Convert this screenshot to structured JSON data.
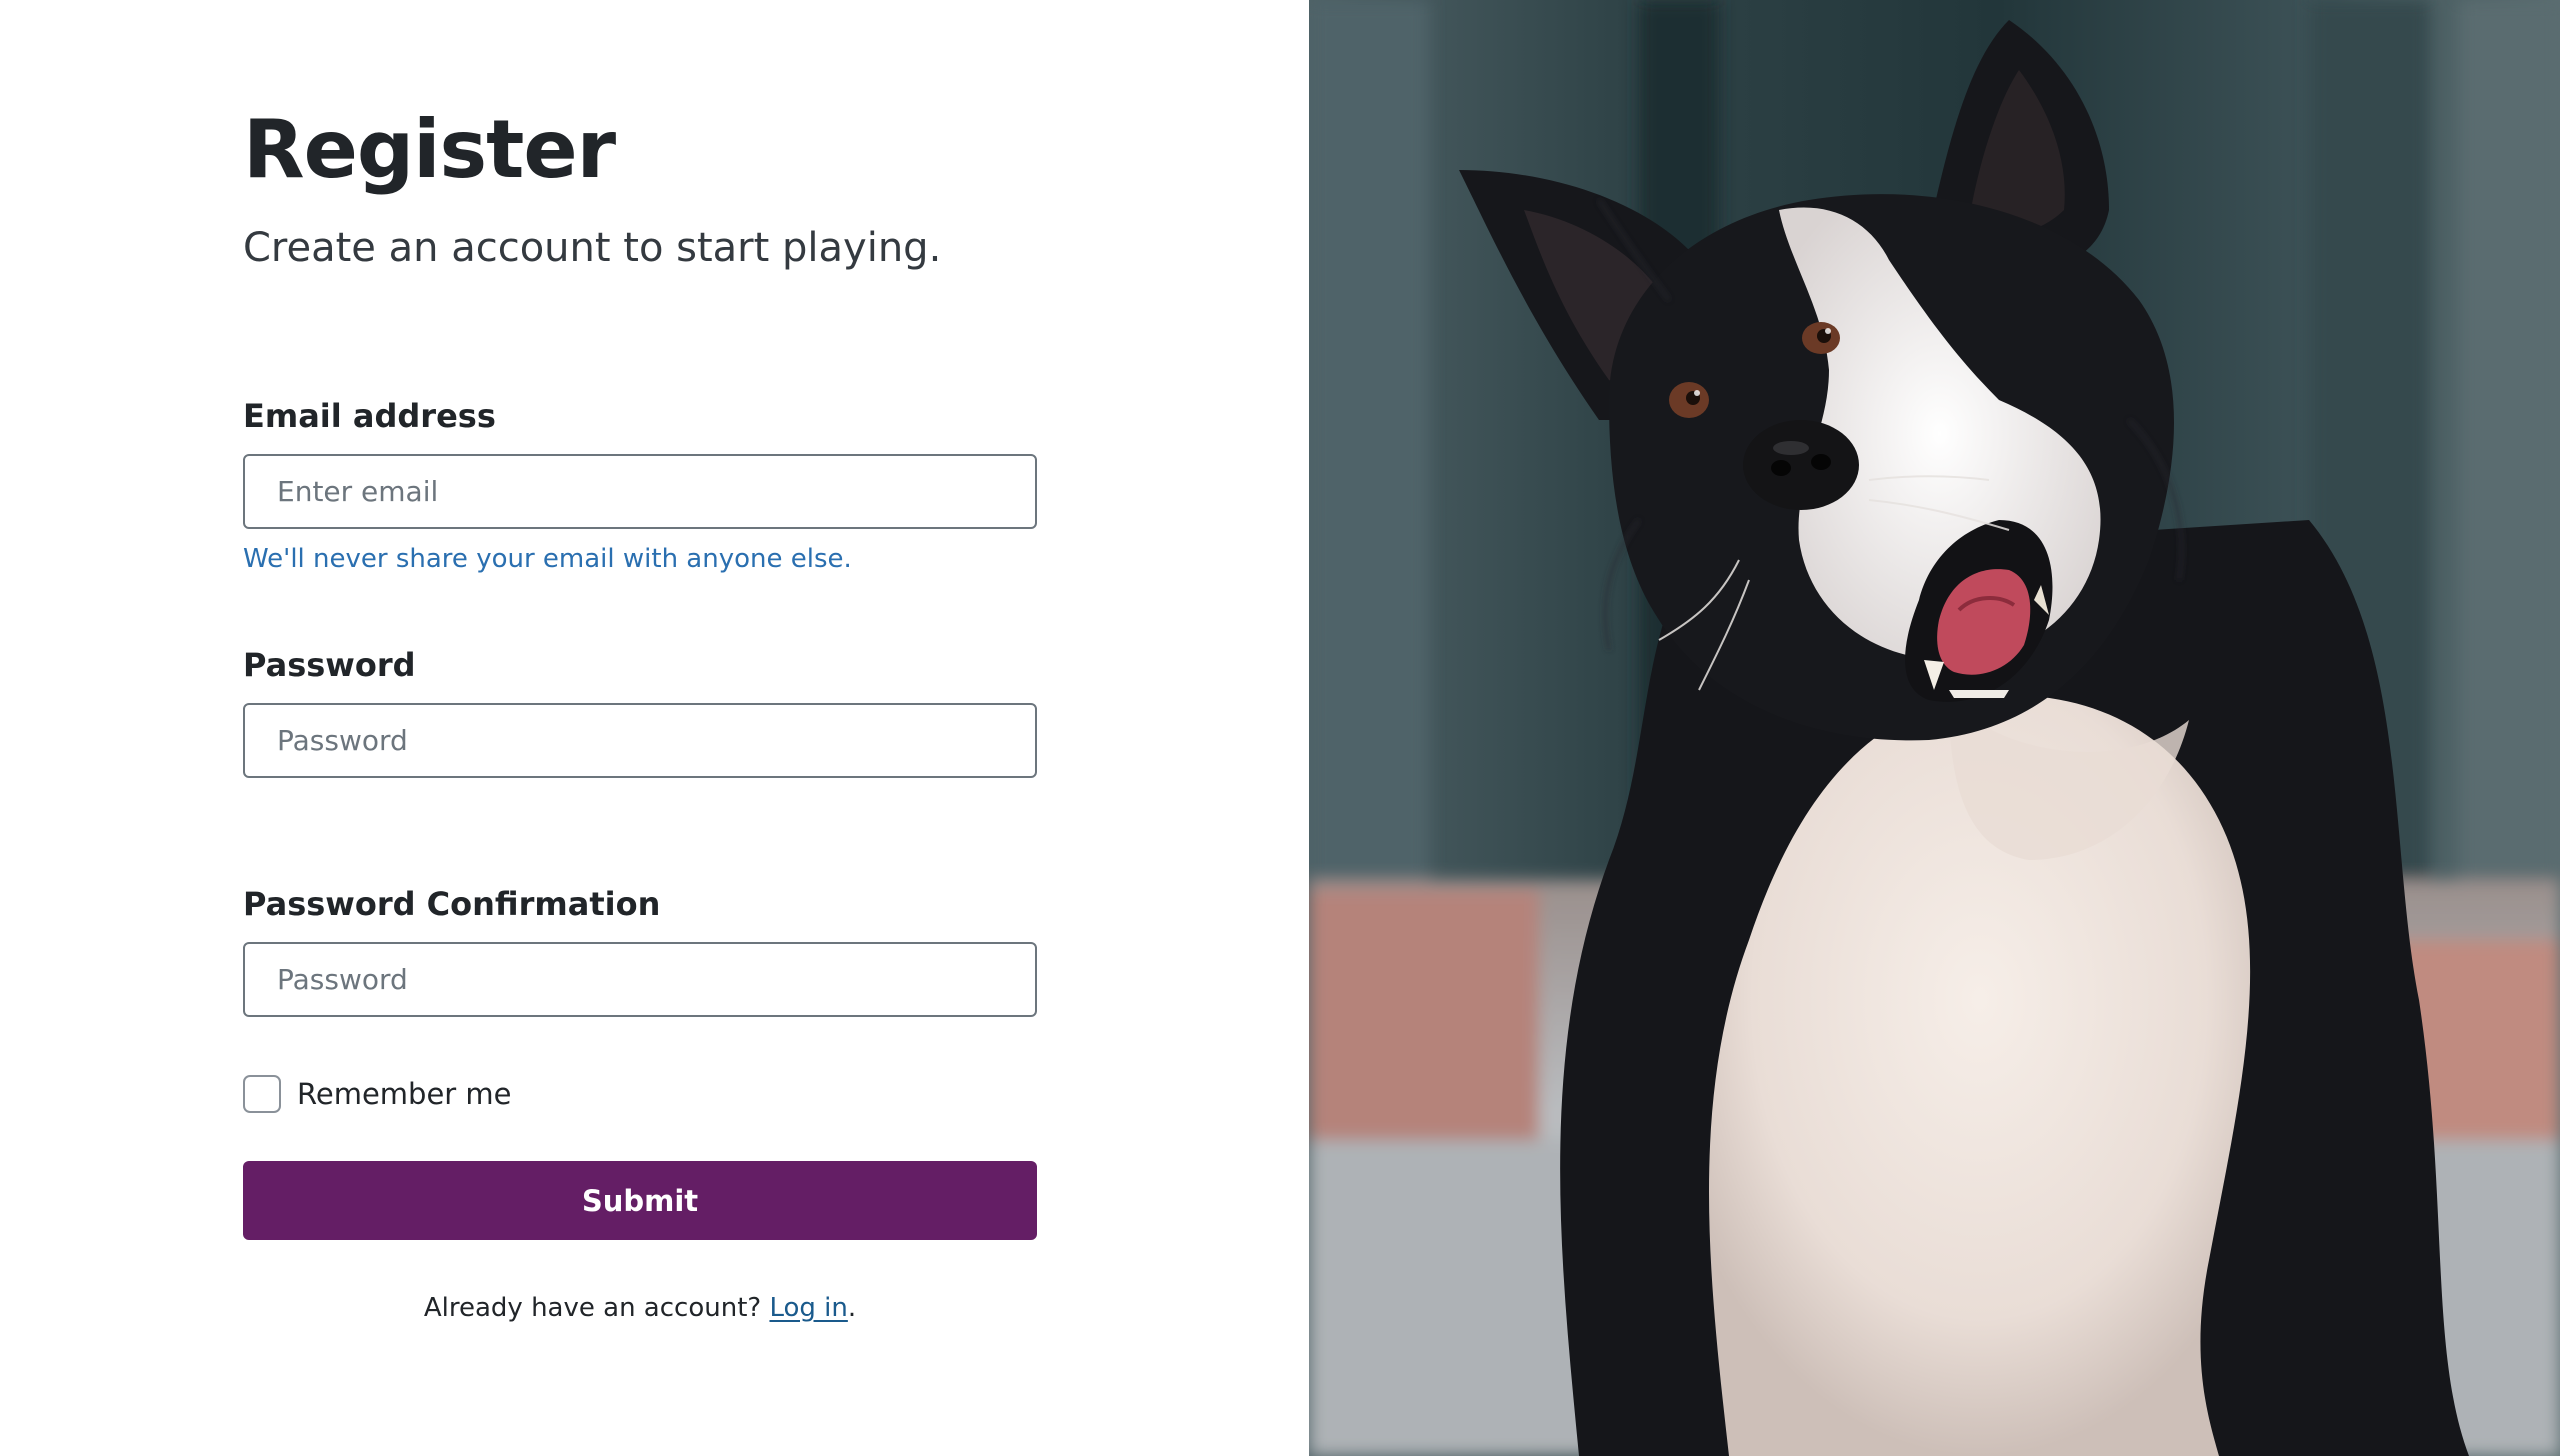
{
  "header": {
    "title": "Register",
    "subtitle": "Create an account to start playing."
  },
  "form": {
    "email": {
      "label": "Email address",
      "placeholder": "Enter email",
      "value": "",
      "help": "We'll never share your email with anyone else."
    },
    "password": {
      "label": "Password",
      "placeholder": "Password",
      "value": ""
    },
    "password_confirmation": {
      "label": "Password Confirmation",
      "placeholder": "Password",
      "value": ""
    },
    "remember": {
      "label": "Remember me",
      "checked": false
    },
    "submit_label": "Submit"
  },
  "footer": {
    "prompt": "Already have an account?",
    "link_label": "Log in",
    "trailing": "."
  },
  "colors": {
    "brand_purple": "#641e65",
    "help_blue": "#2a6fb0",
    "link_blue": "#1a5a8c"
  },
  "hero_image": {
    "subject": "border-collie-dog-photo"
  }
}
